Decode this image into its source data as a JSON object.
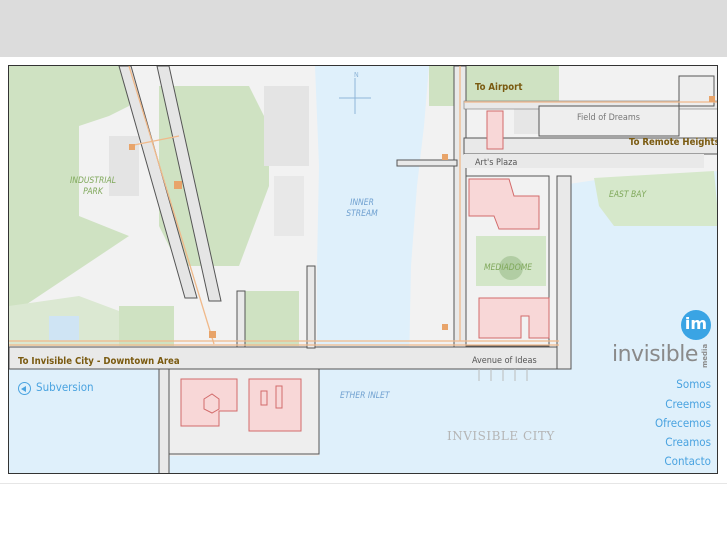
{
  "map": {
    "destinations": {
      "airport": "To Airport",
      "remote_heights": "To Remote Heights",
      "downtown": "To Invisible City - Downtown Area"
    },
    "places": {
      "field_of_dreams": "Field of Dreams",
      "arts_plaza": "Art's Plaza",
      "avenue_of_ideas": "Avenue of Ideas",
      "mediadome": "MEDIADOME",
      "east_bay": "EAST BAY",
      "industrial_park_1": "INDUSTRIAL",
      "industrial_park_2": "PARK",
      "inner_stream_1": "INNER",
      "inner_stream_2": "STREAM",
      "ether_inlet": "ETHER INLET",
      "invisible_city": "INVISIBLE CITY"
    },
    "compass_label": "N",
    "back_link": "Subversion"
  },
  "logo": {
    "mark": "im",
    "word": "invisible",
    "sub": "media"
  },
  "nav": {
    "items": [
      "Somos",
      "Creemos",
      "Ofrecemos",
      "Creamos",
      "Contacto"
    ]
  },
  "colors": {
    "water": "#dff0fb",
    "park": "#cfe2c2",
    "building": "#f8d7d7",
    "road_line": "#f0b98a",
    "accent": "#4aa3e0"
  }
}
